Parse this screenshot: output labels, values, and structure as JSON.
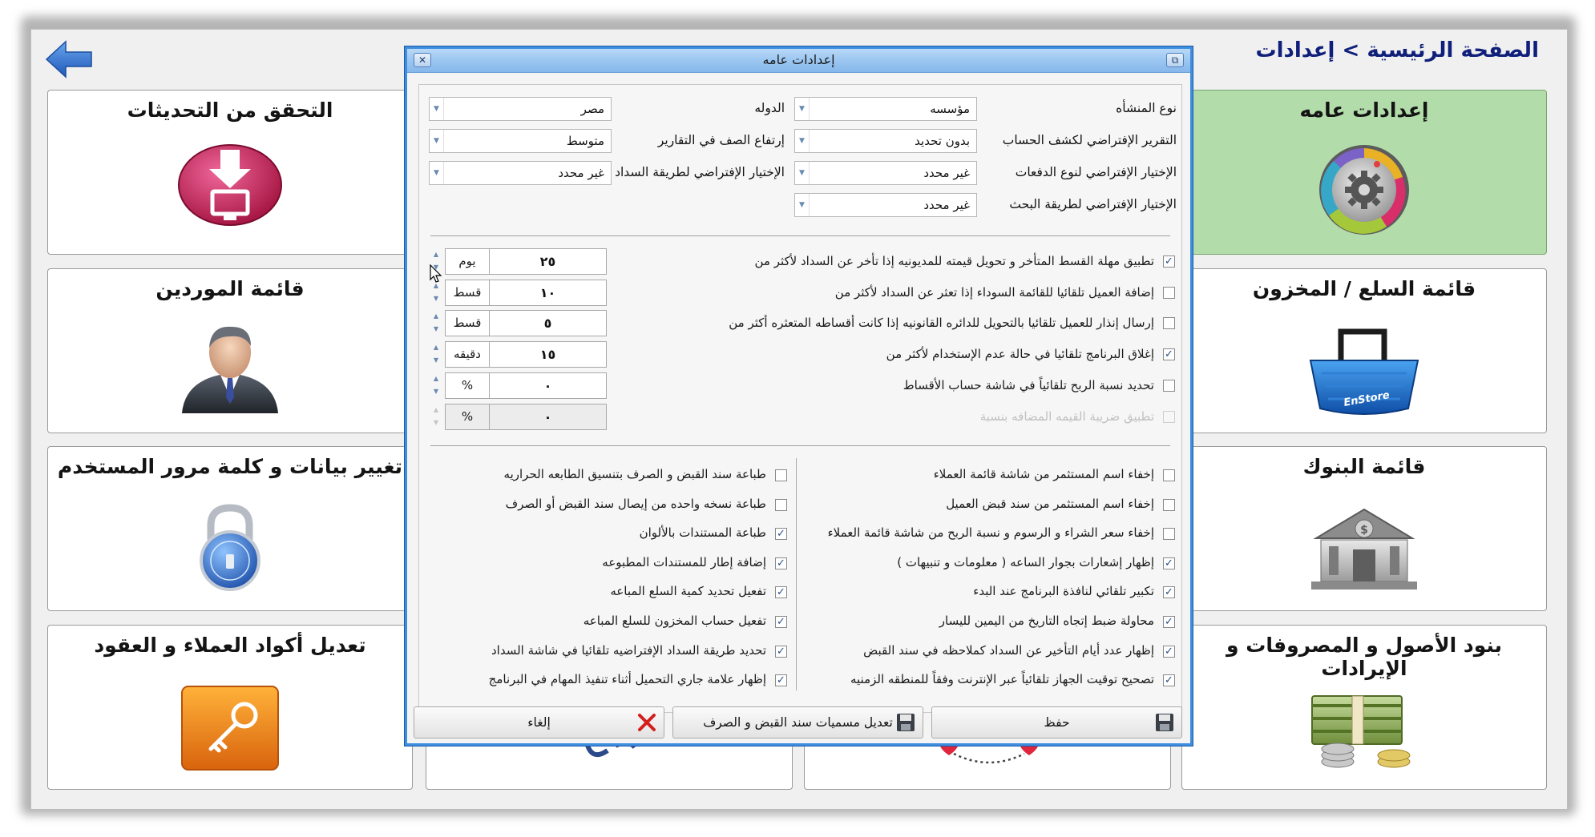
{
  "page": {
    "breadcrumb": "الصفحة الرئيسية > إعدادات"
  },
  "tiles": {
    "general_settings": "إعدادات عامه",
    "check_updates": "التحقق من التحديثات",
    "items_inventory": "قائمة السلع / المخزون",
    "suppliers": "قائمة الموردين",
    "banks": "قائمة البنوك",
    "user_credentials": "تغيير بيانات و كلمة مرور المستخدم",
    "assets_expenses_revenues": "بنود الأصول و المصروفات و الإيرادات",
    "client_codes": "تعديل أكواد العملاء و العقود",
    "basket_brand": "EnStore"
  },
  "dialog": {
    "title": "إعدادات عامه",
    "fields": {
      "entity_type": {
        "label": "نوع المنشأه",
        "value": "مؤسسه"
      },
      "country": {
        "label": "الدوله",
        "value": "مصر"
      },
      "statement_report": {
        "label": "التقرير الإفتراضي لكشف الحساب",
        "value": "بدون تحديد"
      },
      "row_height": {
        "label": "إرتفاع الصف في التقارير",
        "value": "متوسط"
      },
      "payment_type": {
        "label": "الإختيار الإفتراضي لنوع الدفعات",
        "value": "غير محدد"
      },
      "payment_method": {
        "label": "الإختيار الإفتراضي لطريقة السداد",
        "value": "غير محدد"
      },
      "search_method": {
        "label": "الإختيار الإفتراضي لطريقة البحث",
        "value": "غير محدد"
      }
    },
    "numeric_options": [
      {
        "label": "تطبيق مهلة القسط المتأخر و تحويل قيمته للمديونيه إذا تأخر عن السداد لأكثر من",
        "checked": true,
        "value": "٢٥",
        "unit": "يوم",
        "disabled": false
      },
      {
        "label": "إضافة العميل تلقائيا للقائمة السوداء إذا تعثر عن السداد لأكثر من",
        "checked": false,
        "value": "١٠",
        "unit": "قسط",
        "disabled": false
      },
      {
        "label": "إرسال إنذار للعميل تلقائيا بالتحويل للدائره القانونيه إذا كانت أقساطه المتعثره أكثر من",
        "checked": false,
        "value": "٥",
        "unit": "قسط",
        "disabled": false
      },
      {
        "label": "إغلاق البرنامج تلقائيا في حالة عدم الإستخدام لأكثر من",
        "checked": true,
        "value": "١٥",
        "unit": "دقيقه",
        "disabled": false
      },
      {
        "label": "تحديد نسبة الربح تلقائياً في شاشة حساب الأقساط",
        "checked": false,
        "value": "٠",
        "unit": "%",
        "disabled": false
      },
      {
        "label": "تطبيق ضريبة القيمه المضافه بنسبة",
        "checked": false,
        "value": "٠",
        "unit": "%",
        "disabled": true
      }
    ],
    "right_options": [
      {
        "label": "إخفاء اسم المستثمر من شاشة قائمة العملاء",
        "checked": false
      },
      {
        "label": "إخفاء اسم المستثمر من سند قبض العميل",
        "checked": false
      },
      {
        "label": "إخفاء سعر الشراء و الرسوم و نسبة الربح من شاشة قائمة العملاء",
        "checked": false
      },
      {
        "label": "إظهار إشعارات بجوار الساعه ( معلومات و تنبيهات )",
        "checked": true
      },
      {
        "label": "تكبير تلقائي لنافذة البرنامج عند البدء",
        "checked": true
      },
      {
        "label": "محاولة ضبط إتجاه التاريخ من اليمين لليسار",
        "checked": true
      },
      {
        "label": "إظهار عدد أيام التأخير عن السداد كملاحظه في سند القبض",
        "checked": true
      },
      {
        "label": "تصحيح توقيت الجهاز تلقائياً عبر الإنترنت وفقاً للمنطقه الزمنيه",
        "checked": true
      }
    ],
    "left_options": [
      {
        "label": "طباعة سند القبض و الصرف بتنسيق الطابعه الحراريه",
        "checked": false
      },
      {
        "label": "طباعة نسخه واحده من إيصال سند القبض أو الصرف",
        "checked": false
      },
      {
        "label": "طباعة المستندات بالألوان",
        "checked": true
      },
      {
        "label": "إضافة إطار للمستندات المطبوعه",
        "checked": true
      },
      {
        "label": "تفعيل تحديد كمية السلع المباعه",
        "checked": true
      },
      {
        "label": "تفعيل حساب المخزون للسلع المباعه",
        "checked": true
      },
      {
        "label": "تحديد طريقة السداد الإفتراضيه تلقائيا في شاشة السداد",
        "checked": true
      },
      {
        "label": "إظهار علامة جاري التحميل أثناء تنفيذ المهام في البرنامج",
        "checked": true
      }
    ],
    "buttons": {
      "save": "حفظ",
      "rename_vouchers": "تعديل مسميات سند القبض و الصرف",
      "cancel": "إلغاء"
    }
  },
  "colors": {
    "titlebar": "#9ec8f1",
    "active_tile": "#b2ddaa",
    "breadcrumb": "#0f1f7a",
    "back_arrow": "#2f6fd0",
    "check_mark": "#2a4e86"
  },
  "icons": {
    "back": "arrow-left-icon",
    "general_settings": "gear-dial-icon",
    "updates": "download-monitor-icon",
    "inventory": "basket-icon",
    "suppliers": "businessman-icon",
    "banks": "bank-building-icon",
    "user": "padlock-icon",
    "assets": "money-stack-icon",
    "client_codes": "key-icon",
    "save": "floppy-disk-icon",
    "cancel": "red-x-icon"
  }
}
